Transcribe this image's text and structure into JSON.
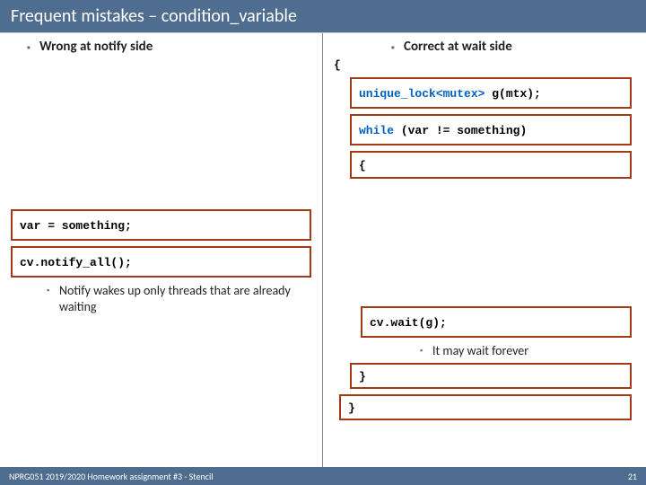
{
  "title": "Frequent mistakes – condition_variable",
  "left": {
    "heading": "Wrong at notify side",
    "code1": "var = something;",
    "code2": "cv.notify_all();",
    "note": "Notify wakes up only threads that are already waiting"
  },
  "right": {
    "heading": "Correct at wait side",
    "brace_open": "{",
    "line1a": "unique_lock<mutex>",
    "line1b": " g(mtx);",
    "line2a": "while",
    "line2b": " (var != something)",
    "brace_inner_open": "{",
    "line3": "cv.wait(g);",
    "note": "It may wait forever",
    "brace_inner_close": "}",
    "brace_close": "}"
  },
  "footer": {
    "left": "NPRG051 2019/2020 Homework assignment #3 - Stencil",
    "right": "21"
  }
}
